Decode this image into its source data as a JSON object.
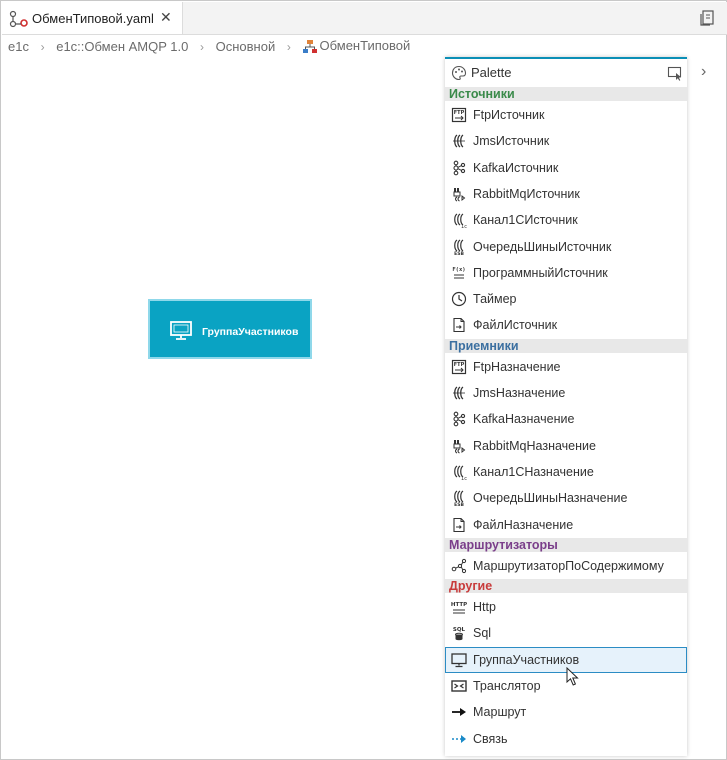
{
  "tab": {
    "title": "ОбменТиповой.yaml",
    "close": "✕"
  },
  "breadcrumb": [
    "e1c",
    "e1c::Обмен AMQP 1.0",
    "Основной",
    "ОбменТиповой"
  ],
  "breadcrumb_separator": "›",
  "node": {
    "label": "ГруппаУчастников",
    "color": "#0aa3c3"
  },
  "palette": {
    "title": "Palette",
    "collapse": "›",
    "categories": [
      {
        "label": "Источники",
        "color": "#3a8a4a",
        "items": [
          {
            "label": "FtpИсточник",
            "icon": "ftp-icon"
          },
          {
            "label": "JmsИсточник",
            "icon": "jms-icon"
          },
          {
            "label": "KafkaИсточник",
            "icon": "kafka-icon"
          },
          {
            "label": "RabbitMqИсточник",
            "icon": "rabbitmq-icon"
          },
          {
            "label": "Канал1СИсточник",
            "icon": "channel-1c-icon"
          },
          {
            "label": "ОчередьШиныИсточник",
            "icon": "esb-queue-icon"
          },
          {
            "label": "ПрограммныйИсточник",
            "icon": "program-icon"
          },
          {
            "label": "Таймер",
            "icon": "clock-icon"
          },
          {
            "label": "ФайлИсточник",
            "icon": "file-icon"
          }
        ]
      },
      {
        "label": "Приемники",
        "color": "#3b6fa0",
        "items": [
          {
            "label": "FtpНазначение",
            "icon": "ftp-icon"
          },
          {
            "label": "JmsНазначение",
            "icon": "jms-icon"
          },
          {
            "label": "KafkaНазначение",
            "icon": "kafka-icon"
          },
          {
            "label": "RabbitMqНазначение",
            "icon": "rabbitmq-icon"
          },
          {
            "label": "Канал1СНазначение",
            "icon": "channel-1c-icon"
          },
          {
            "label": "ОчередьШиныНазначение",
            "icon": "esb-queue-icon"
          },
          {
            "label": "ФайлНазначение",
            "icon": "file-icon"
          }
        ]
      },
      {
        "label": "Маршрутизаторы",
        "color": "#7a3e8a",
        "items": [
          {
            "label": "МаршрутизаторПоСодержимому",
            "icon": "router-icon"
          }
        ]
      },
      {
        "label": "Другие",
        "color": "#c83a3a",
        "items": [
          {
            "label": "Http",
            "icon": "http-icon"
          },
          {
            "label": "Sql",
            "icon": "sql-icon"
          },
          {
            "label": "ГруппаУчастников",
            "icon": "monitor-icon",
            "selected": true
          },
          {
            "label": "Транслятор",
            "icon": "translator-icon"
          },
          {
            "label": "Маршрут",
            "icon": "arrow-right-icon"
          },
          {
            "label": "Связь",
            "icon": "link-icon"
          }
        ]
      }
    ]
  }
}
